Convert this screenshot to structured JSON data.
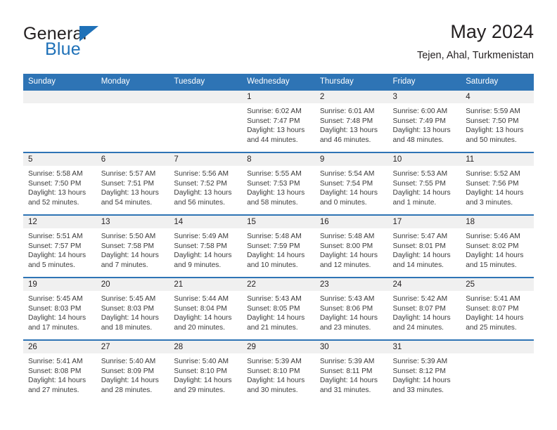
{
  "brand": {
    "name_part1": "General",
    "name_part2": "Blue",
    "logo_icon": "triangle-icon",
    "accent_color": "#1f71b8"
  },
  "header": {
    "title": "May 2024",
    "subtitle": "Tejen, Ahal, Turkmenistan",
    "header_bg_color": "#2e74b5",
    "daynum_band_color": "#f0f0f0"
  },
  "weekday_headers": [
    "Sunday",
    "Monday",
    "Tuesday",
    "Wednesday",
    "Thursday",
    "Friday",
    "Saturday"
  ],
  "labels": {
    "sunrise_prefix": "Sunrise:",
    "sunset_prefix": "Sunset:",
    "daylight_prefix": "Daylight:"
  },
  "weeks": [
    [
      {
        "day": "",
        "empty": true
      },
      {
        "day": "",
        "empty": true
      },
      {
        "day": "",
        "empty": true
      },
      {
        "day": "1",
        "sunrise": "Sunrise: 6:02 AM",
        "sunset": "Sunset: 7:47 PM",
        "daylight": "Daylight: 13 hours and 44 minutes."
      },
      {
        "day": "2",
        "sunrise": "Sunrise: 6:01 AM",
        "sunset": "Sunset: 7:48 PM",
        "daylight": "Daylight: 13 hours and 46 minutes."
      },
      {
        "day": "3",
        "sunrise": "Sunrise: 6:00 AM",
        "sunset": "Sunset: 7:49 PM",
        "daylight": "Daylight: 13 hours and 48 minutes."
      },
      {
        "day": "4",
        "sunrise": "Sunrise: 5:59 AM",
        "sunset": "Sunset: 7:50 PM",
        "daylight": "Daylight: 13 hours and 50 minutes."
      }
    ],
    [
      {
        "day": "5",
        "sunrise": "Sunrise: 5:58 AM",
        "sunset": "Sunset: 7:50 PM",
        "daylight": "Daylight: 13 hours and 52 minutes."
      },
      {
        "day": "6",
        "sunrise": "Sunrise: 5:57 AM",
        "sunset": "Sunset: 7:51 PM",
        "daylight": "Daylight: 13 hours and 54 minutes."
      },
      {
        "day": "7",
        "sunrise": "Sunrise: 5:56 AM",
        "sunset": "Sunset: 7:52 PM",
        "daylight": "Daylight: 13 hours and 56 minutes."
      },
      {
        "day": "8",
        "sunrise": "Sunrise: 5:55 AM",
        "sunset": "Sunset: 7:53 PM",
        "daylight": "Daylight: 13 hours and 58 minutes."
      },
      {
        "day": "9",
        "sunrise": "Sunrise: 5:54 AM",
        "sunset": "Sunset: 7:54 PM",
        "daylight": "Daylight: 14 hours and 0 minutes."
      },
      {
        "day": "10",
        "sunrise": "Sunrise: 5:53 AM",
        "sunset": "Sunset: 7:55 PM",
        "daylight": "Daylight: 14 hours and 1 minute."
      },
      {
        "day": "11",
        "sunrise": "Sunrise: 5:52 AM",
        "sunset": "Sunset: 7:56 PM",
        "daylight": "Daylight: 14 hours and 3 minutes."
      }
    ],
    [
      {
        "day": "12",
        "sunrise": "Sunrise: 5:51 AM",
        "sunset": "Sunset: 7:57 PM",
        "daylight": "Daylight: 14 hours and 5 minutes."
      },
      {
        "day": "13",
        "sunrise": "Sunrise: 5:50 AM",
        "sunset": "Sunset: 7:58 PM",
        "daylight": "Daylight: 14 hours and 7 minutes."
      },
      {
        "day": "14",
        "sunrise": "Sunrise: 5:49 AM",
        "sunset": "Sunset: 7:58 PM",
        "daylight": "Daylight: 14 hours and 9 minutes."
      },
      {
        "day": "15",
        "sunrise": "Sunrise: 5:48 AM",
        "sunset": "Sunset: 7:59 PM",
        "daylight": "Daylight: 14 hours and 10 minutes."
      },
      {
        "day": "16",
        "sunrise": "Sunrise: 5:48 AM",
        "sunset": "Sunset: 8:00 PM",
        "daylight": "Daylight: 14 hours and 12 minutes."
      },
      {
        "day": "17",
        "sunrise": "Sunrise: 5:47 AM",
        "sunset": "Sunset: 8:01 PM",
        "daylight": "Daylight: 14 hours and 14 minutes."
      },
      {
        "day": "18",
        "sunrise": "Sunrise: 5:46 AM",
        "sunset": "Sunset: 8:02 PM",
        "daylight": "Daylight: 14 hours and 15 minutes."
      }
    ],
    [
      {
        "day": "19",
        "sunrise": "Sunrise: 5:45 AM",
        "sunset": "Sunset: 8:03 PM",
        "daylight": "Daylight: 14 hours and 17 minutes."
      },
      {
        "day": "20",
        "sunrise": "Sunrise: 5:45 AM",
        "sunset": "Sunset: 8:03 PM",
        "daylight": "Daylight: 14 hours and 18 minutes."
      },
      {
        "day": "21",
        "sunrise": "Sunrise: 5:44 AM",
        "sunset": "Sunset: 8:04 PM",
        "daylight": "Daylight: 14 hours and 20 minutes."
      },
      {
        "day": "22",
        "sunrise": "Sunrise: 5:43 AM",
        "sunset": "Sunset: 8:05 PM",
        "daylight": "Daylight: 14 hours and 21 minutes."
      },
      {
        "day": "23",
        "sunrise": "Sunrise: 5:43 AM",
        "sunset": "Sunset: 8:06 PM",
        "daylight": "Daylight: 14 hours and 23 minutes."
      },
      {
        "day": "24",
        "sunrise": "Sunrise: 5:42 AM",
        "sunset": "Sunset: 8:07 PM",
        "daylight": "Daylight: 14 hours and 24 minutes."
      },
      {
        "day": "25",
        "sunrise": "Sunrise: 5:41 AM",
        "sunset": "Sunset: 8:07 PM",
        "daylight": "Daylight: 14 hours and 25 minutes."
      }
    ],
    [
      {
        "day": "26",
        "sunrise": "Sunrise: 5:41 AM",
        "sunset": "Sunset: 8:08 PM",
        "daylight": "Daylight: 14 hours and 27 minutes."
      },
      {
        "day": "27",
        "sunrise": "Sunrise: 5:40 AM",
        "sunset": "Sunset: 8:09 PM",
        "daylight": "Daylight: 14 hours and 28 minutes."
      },
      {
        "day": "28",
        "sunrise": "Sunrise: 5:40 AM",
        "sunset": "Sunset: 8:10 PM",
        "daylight": "Daylight: 14 hours and 29 minutes."
      },
      {
        "day": "29",
        "sunrise": "Sunrise: 5:39 AM",
        "sunset": "Sunset: 8:10 PM",
        "daylight": "Daylight: 14 hours and 30 minutes."
      },
      {
        "day": "30",
        "sunrise": "Sunrise: 5:39 AM",
        "sunset": "Sunset: 8:11 PM",
        "daylight": "Daylight: 14 hours and 31 minutes."
      },
      {
        "day": "31",
        "sunrise": "Sunrise: 5:39 AM",
        "sunset": "Sunset: 8:12 PM",
        "daylight": "Daylight: 14 hours and 33 minutes."
      },
      {
        "day": "",
        "empty": true
      }
    ]
  ]
}
